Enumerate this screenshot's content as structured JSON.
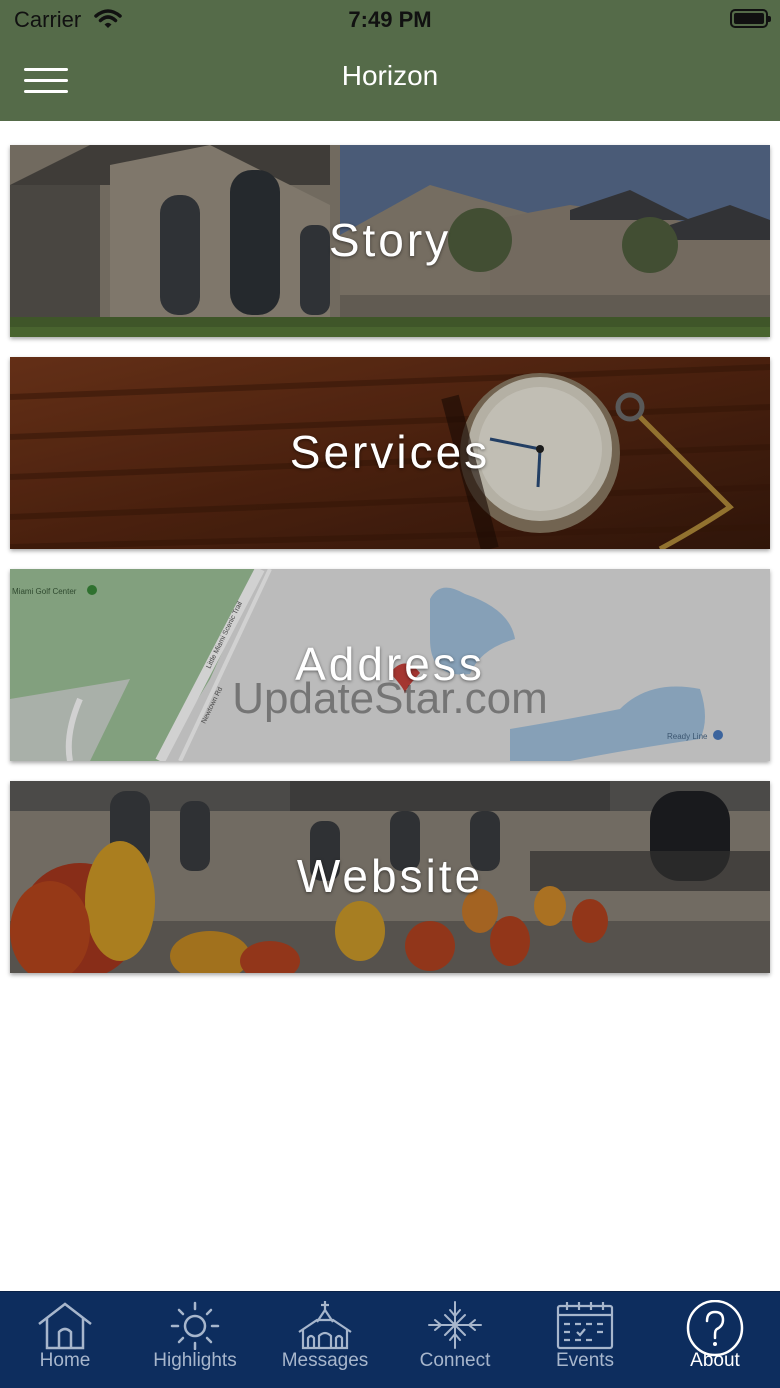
{
  "status_bar": {
    "carrier": "Carrier",
    "time": "7:49 PM"
  },
  "nav": {
    "title": "Horizon",
    "menu_icon": "hamburger-menu-icon"
  },
  "tiles": [
    {
      "label": "Story"
    },
    {
      "label": "Services"
    },
    {
      "label": "Address"
    },
    {
      "label": "Website"
    }
  ],
  "map_labels": {
    "golf": "Miami Golf Center",
    "trail": "Little Miami Scenic Trail",
    "road": "Newtown Rd",
    "ready": "Ready Line"
  },
  "watermark": "UpdateStar.com",
  "tabs": [
    {
      "label": "Home",
      "icon": "house-icon"
    },
    {
      "label": "Highlights",
      "icon": "sun-icon"
    },
    {
      "label": "Messages",
      "icon": "church-icon"
    },
    {
      "label": "Connect",
      "icon": "connect-icon"
    },
    {
      "label": "Events",
      "icon": "calendar-icon"
    },
    {
      "label": "About",
      "icon": "question-icon",
      "active": true
    }
  ],
  "colors": {
    "header": "#556b49",
    "tabbar": "#0d2d5e",
    "tab_inactive": "#a7b6cc",
    "tab_active": "#ffffff"
  }
}
